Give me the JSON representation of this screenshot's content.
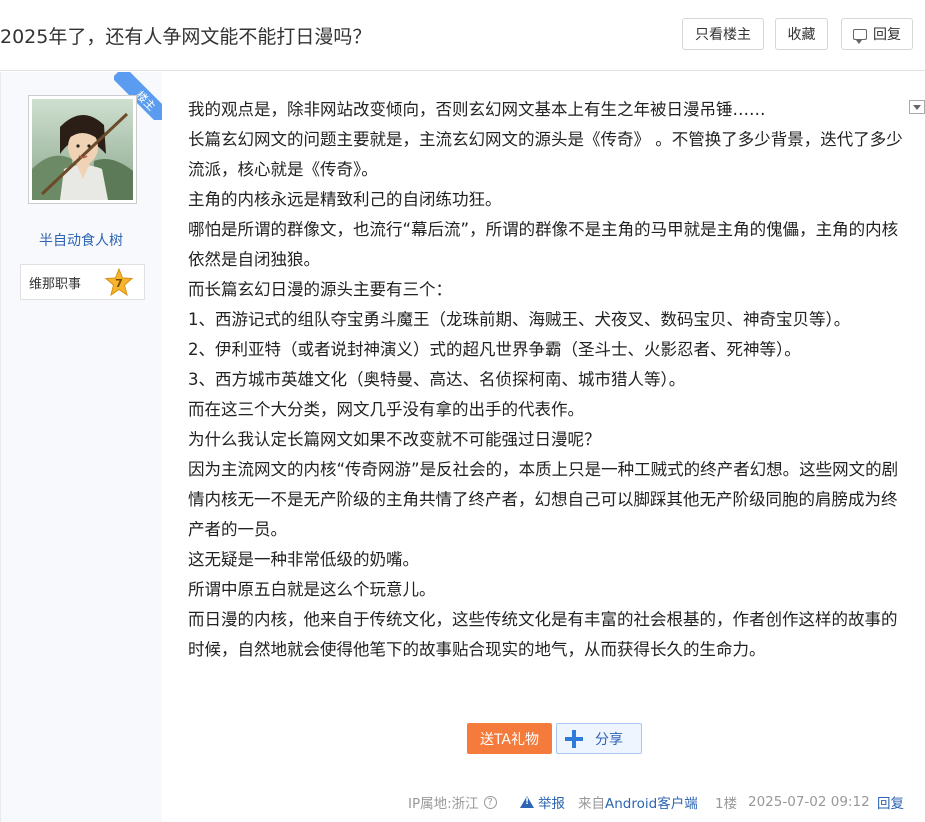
{
  "header": {
    "title": "2025年了，还有人争网文能不能打日漫吗？",
    "only_author_label": "只看楼主",
    "favorite_label": "收藏",
    "reply_label": "回复"
  },
  "author": {
    "ribbon": "楼主",
    "username": "半自动食人树",
    "badge_label": "维那职事",
    "badge_level": "7"
  },
  "post": {
    "paragraphs": [
      "我的观点是，除非网站改变倾向，否则玄幻网文基本上有生之年被日漫吊锤……",
      "长篇玄幻网文的问题主要就是，主流玄幻网文的源头是《传奇》 。不管换了多少背景，迭代了多少流派，核心就是《传奇》。",
      "主角的内核永远是精致利己的自闭练功狂。",
      "哪怕是所谓的群像文，也流行“幕后流”，所谓的群像不是主角的马甲就是主角的傀儡，主角的内核依然是自闭独狼。",
      "而长篇玄幻日漫的源头主要有三个：",
      "1、西游记式的组队夺宝勇斗魔王（龙珠前期、海贼王、犬夜叉、数码宝贝、神奇宝贝等）。",
      "2、伊利亚特（或者说封神演义）式的超凡世界争霸（圣斗士、火影忍者、死神等）。",
      "3、西方城市英雄文化（奥特曼、高达、名侦探柯南、城市猎人等）。",
      "而在这三个大分类，网文几乎没有拿的出手的代表作。",
      "为什么我认定长篇网文如果不改变就不可能强过日漫呢？",
      "因为主流网文的内核“传奇网游”是反社会的，本质上只是一种工贼式的终产者幻想。这些网文的剧情内核无一不是无产阶级的主角共情了终产者，幻想自己可以脚踩其他无产阶级同胞的肩膀成为终产者的一员。",
      "这无疑是一种非常低级的奶嘴。",
      "所谓中原五白就是这么个玩意儿。",
      "而日漫的内核，他来自于传统文化，这些传统文化是有丰富的社会根基的，作者创作这样的故事的时候，自然地就会使得他笔下的故事贴合现实的地气，从而获得长久的生命力。"
    ],
    "gift_label": "送TA礼物",
    "share_label": "分享"
  },
  "footer": {
    "ip": "IP属地:浙江",
    "help_glyph": "?",
    "report": "举报",
    "source_prefix": "来自",
    "source_client": "Android客户端",
    "floor": "1楼",
    "time": "2025-07-02 09:12",
    "reply": "回复"
  },
  "colors": {
    "link": "#2d64b3",
    "gift": "#f47b3c",
    "ribbon": "#5b9cf0"
  }
}
